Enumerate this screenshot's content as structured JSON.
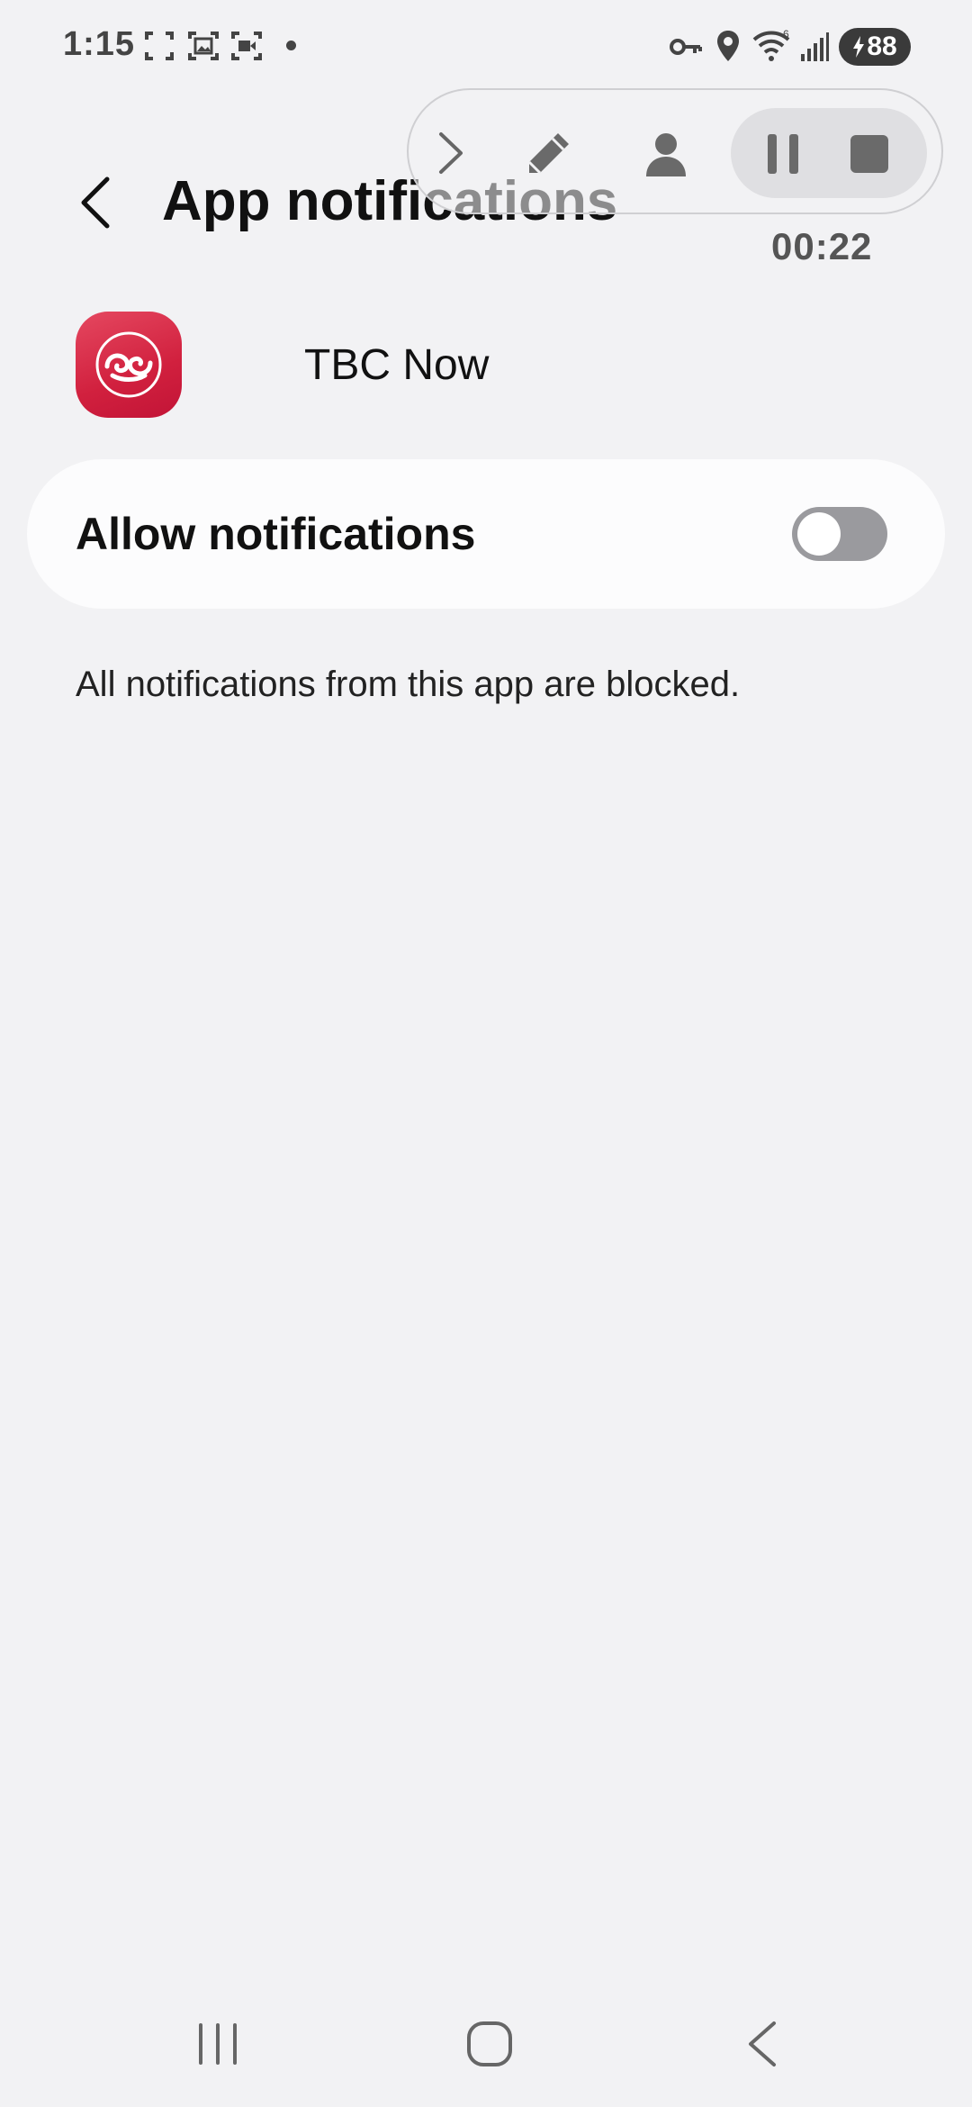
{
  "status_bar": {
    "time": "1:15",
    "battery_level": "88",
    "left_icons": [
      "screenshot-frame-icon",
      "gallery-capture-icon",
      "video-capture-icon",
      "notification-dot-icon"
    ],
    "right_icons": [
      "vpn-key-icon",
      "location-icon",
      "wifi-icon",
      "signal-icon",
      "battery-charging-icon"
    ]
  },
  "recorder": {
    "timer": "00:22",
    "icons": [
      "chevron-right-icon",
      "pencil-icon",
      "person-icon",
      "pause-icon",
      "stop-icon"
    ]
  },
  "header": {
    "title": "App notifications",
    "back_icon": "back-chevron-icon"
  },
  "app": {
    "name": "TBC Now",
    "icon": "tbc-now-logo",
    "icon_color": "#d1203e"
  },
  "allow_notifications": {
    "label": "Allow notifications",
    "enabled": false
  },
  "info": {
    "blocked_message": "All notifications from this app are blocked."
  },
  "nav_bar": {
    "buttons": [
      "recent-apps-icon",
      "home-icon",
      "back-icon"
    ]
  },
  "colors": {
    "background": "#f2f2f4",
    "card": "#fcfcfd",
    "switch_off": "#9a9a9e"
  }
}
